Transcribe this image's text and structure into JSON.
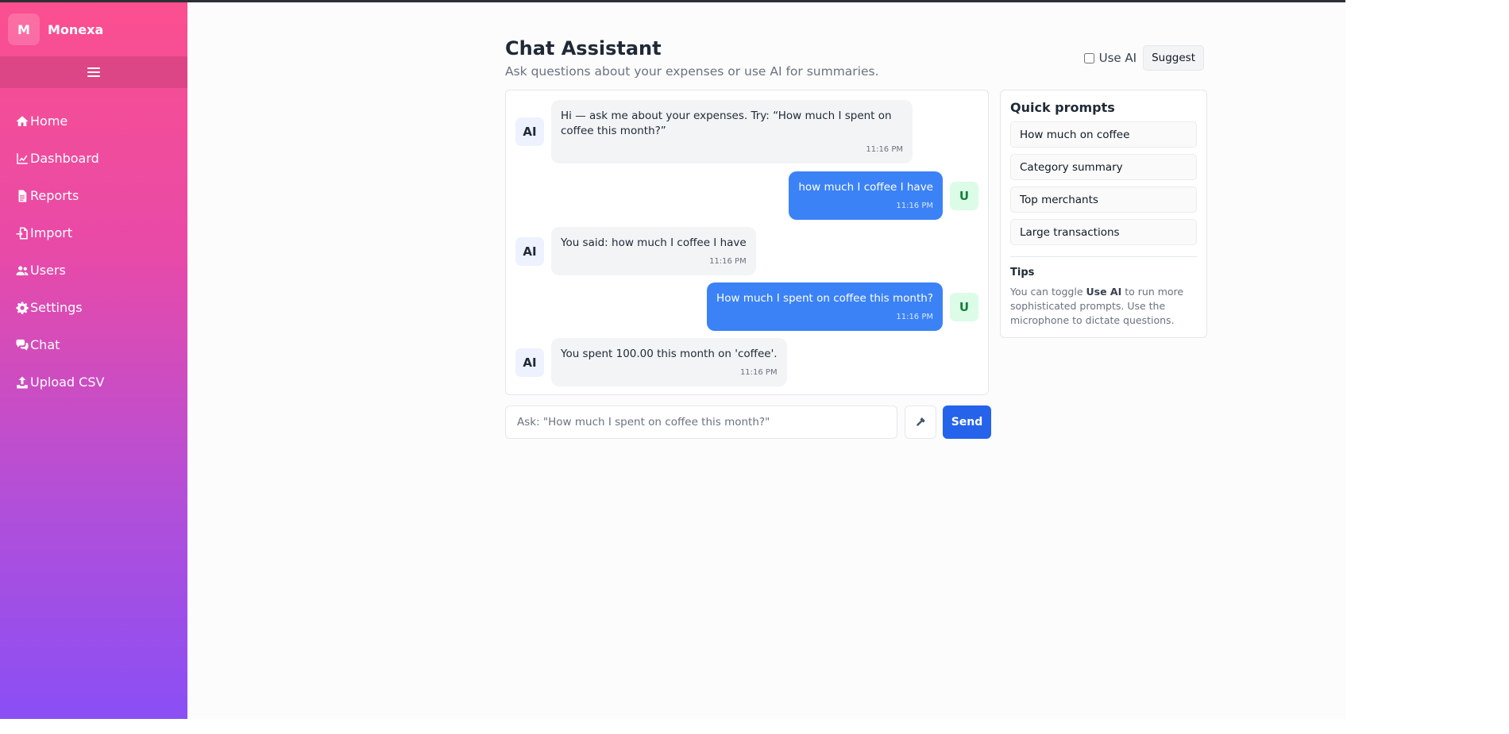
{
  "brand": {
    "badge": "M",
    "name": "Monexa"
  },
  "sidebar": {
    "items": [
      {
        "label": "Home",
        "icon": "home-icon"
      },
      {
        "label": "Dashboard",
        "icon": "chart-line-icon"
      },
      {
        "label": "Reports",
        "icon": "file-icon"
      },
      {
        "label": "Import",
        "icon": "file-import-icon"
      },
      {
        "label": "Users",
        "icon": "users-icon"
      },
      {
        "label": "Settings",
        "icon": "gear-icon"
      },
      {
        "label": "Chat",
        "icon": "chat-icon"
      },
      {
        "label": "Upload CSV",
        "icon": "upload-icon"
      }
    ]
  },
  "header": {
    "title": "Chat Assistant",
    "subtitle": "Ask questions about your expenses or use AI for summaries.",
    "use_ai_label": "Use AI",
    "use_ai_checked": false,
    "suggest_label": "Suggest"
  },
  "messages": [
    {
      "role": "ai",
      "avatar": "AI",
      "text": "Hi — ask me about your expenses. Try: “How much I spent on coffee this month?”",
      "time": "11:16 PM"
    },
    {
      "role": "user",
      "avatar": "U",
      "text": "how much I coffee I have",
      "time": "11:16 PM"
    },
    {
      "role": "ai",
      "avatar": "AI",
      "text": "You said: how much I coffee I have",
      "time": "11:16 PM"
    },
    {
      "role": "user",
      "avatar": "U",
      "text": "How much I spent on coffee this month?",
      "time": "11:16 PM"
    },
    {
      "role": "ai",
      "avatar": "AI",
      "text": "You spent 100.00 this month on 'coffee'.",
      "time": "11:16 PM"
    }
  ],
  "quick_prompts": {
    "title": "Quick prompts",
    "items": [
      "How much on coffee",
      "Category summary",
      "Top merchants",
      "Large transactions"
    ]
  },
  "tips": {
    "title": "Tips",
    "text_prefix": "You can toggle ",
    "text_bold": "Use AI",
    "text_suffix": " to run more sophisticated prompts. Use the microphone to dictate questions."
  },
  "composer": {
    "placeholder": "Ask: \"How much I spent on coffee this month?\"",
    "value": "",
    "mic_icon": "microphone-icon",
    "send_label": "Send"
  },
  "colors": {
    "accent": "#2563eb",
    "user_bubble": "#3b82f6",
    "sidebar_top": "#fb4f8f",
    "sidebar_bottom": "#8a4ff5"
  }
}
